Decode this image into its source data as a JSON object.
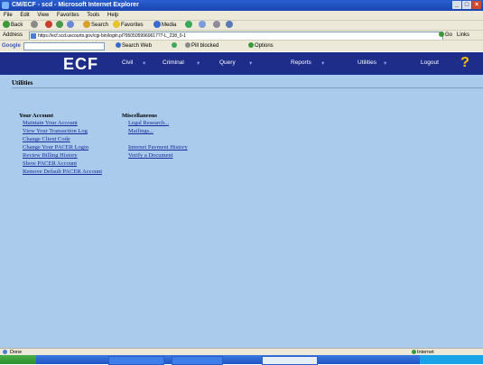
{
  "window": {
    "title": "CM/ECF - scd - Microsoft Internet Explorer"
  },
  "menu": [
    "File",
    "Edit",
    "View",
    "Favorites",
    "Tools",
    "Help"
  ],
  "toolbar": {
    "back": "Back",
    "search": "Search",
    "favorites": "Favorites",
    "media": "Media"
  },
  "address": {
    "label": "Address",
    "url": "https://ecf.scd.uscourts.gov/cgi-bin/login.pl?9505059960617?7-L_238_0-1",
    "go": "Go",
    "links": "Links"
  },
  "google": {
    "label": "Google",
    "search_web": "Search Web",
    "blocked": "Pill blocked",
    "options": "Options"
  },
  "nav": {
    "logo": "ECF",
    "items": [
      "Civil",
      "Criminal",
      "Query",
      "Reports",
      "Utilities",
      "Logout"
    ]
  },
  "page": {
    "heading": "Utilities",
    "your_account": {
      "title": "Your Account",
      "links": [
        "Maintain Your Account",
        "View Your Transaction Log",
        "Change Client Code",
        "Change Your PACER Login",
        "Review Billing History",
        "Show PACER Account",
        "Remove Default PACER Account"
      ]
    },
    "misc": {
      "title": "Miscellaneous",
      "links": [
        "Legal Research...",
        "Mailings...",
        "",
        "Internet Payment History",
        "Verify a Document"
      ]
    }
  },
  "status": {
    "text": "Done",
    "zone": "Internet"
  }
}
